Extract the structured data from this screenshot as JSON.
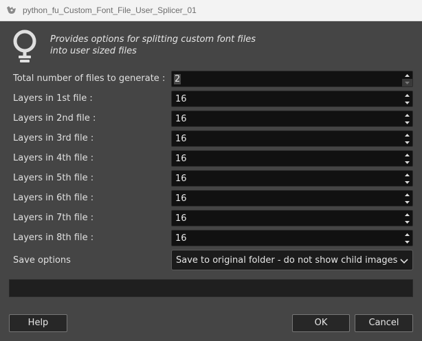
{
  "window": {
    "title": "python_fu_Custom_Font_File_User_Splicer_01",
    "app_icon": "gimp-wilber-icon"
  },
  "header": {
    "icon": "lightbulb-icon",
    "description_line1": "Provides options for splitting custom font files",
    "description_line2": "into user sized files"
  },
  "fields": [
    {
      "label": "Total number of files to generate :",
      "value": "2"
    },
    {
      "label": "Layers in 1st file :",
      "value": "16"
    },
    {
      "label": "Layers in 2nd file :",
      "value": "16"
    },
    {
      "label": "Layers in 3rd file :",
      "value": "16"
    },
    {
      "label": "Layers in 4th file :",
      "value": "16"
    },
    {
      "label": "Layers in 5th file :",
      "value": "16"
    },
    {
      "label": "Layers in 6th file :",
      "value": "16"
    },
    {
      "label": "Layers in 7th file :",
      "value": "16"
    },
    {
      "label": "Layers in 8th file :",
      "value": "16"
    }
  ],
  "save_options": {
    "label": "Save options",
    "selected": "Save to original folder - do not show child images"
  },
  "buttons": {
    "help": "Help",
    "ok": "OK",
    "cancel": "Cancel"
  }
}
